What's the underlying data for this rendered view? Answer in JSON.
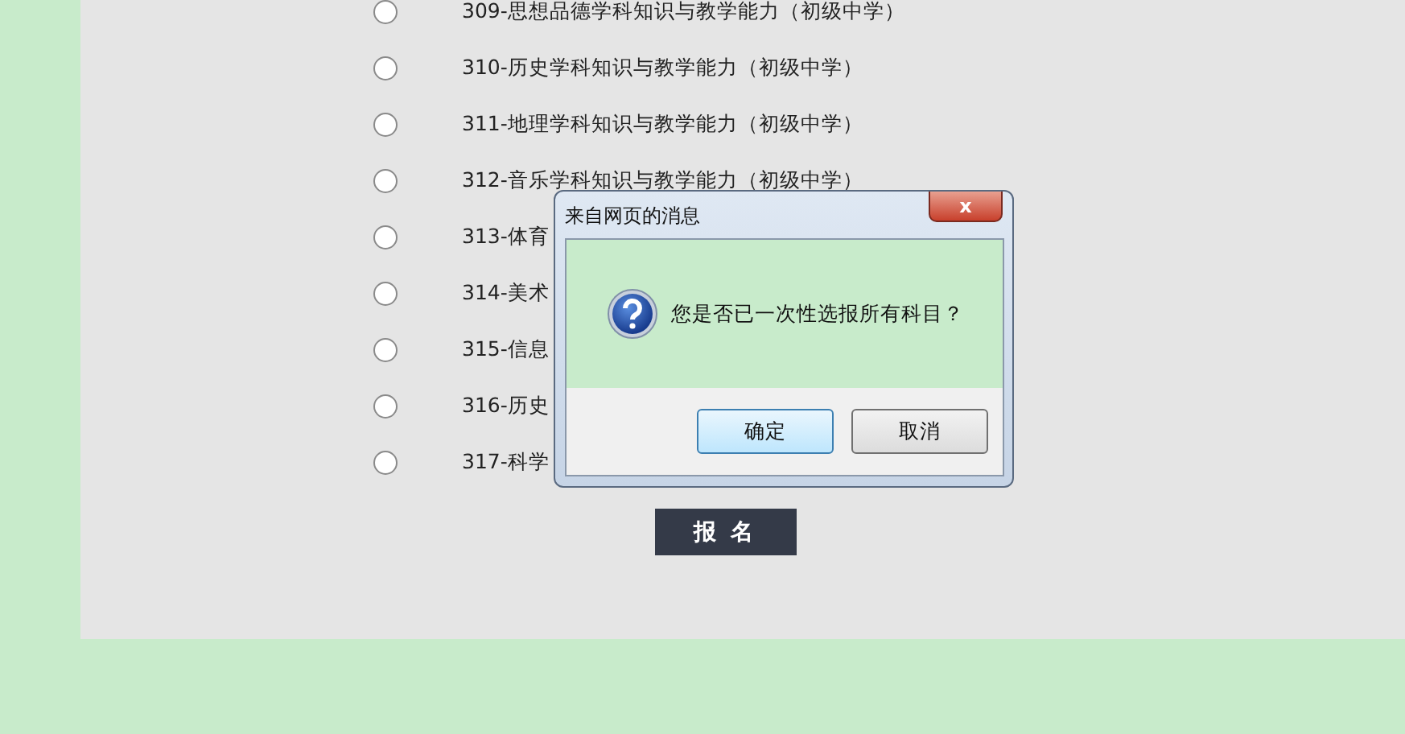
{
  "subjects": [
    {
      "label": "309-思想品德学科知识与教学能力（初级中学）",
      "selected": false
    },
    {
      "label": "310-历史学科知识与教学能力（初级中学）",
      "selected": false
    },
    {
      "label": "311-地理学科知识与教学能力（初级中学）",
      "selected": false
    },
    {
      "label": "312-音乐学科知识与教学能力（初级中学）",
      "selected": false
    },
    {
      "label": "313-体育",
      "selected": false
    },
    {
      "label": "314-美术",
      "selected": false
    },
    {
      "label": "315-信息",
      "selected": false
    },
    {
      "label": "316-历史",
      "selected": false
    },
    {
      "label": "317-科学",
      "selected": false
    }
  ],
  "submit_button": "报 名",
  "dialog": {
    "title": "来自网页的消息",
    "close": "x",
    "message": "您是否已一次性选报所有科目？",
    "buttons": [
      {
        "label": "确定",
        "kind": "default"
      },
      {
        "label": "取消",
        "kind": "normal"
      }
    ]
  }
}
